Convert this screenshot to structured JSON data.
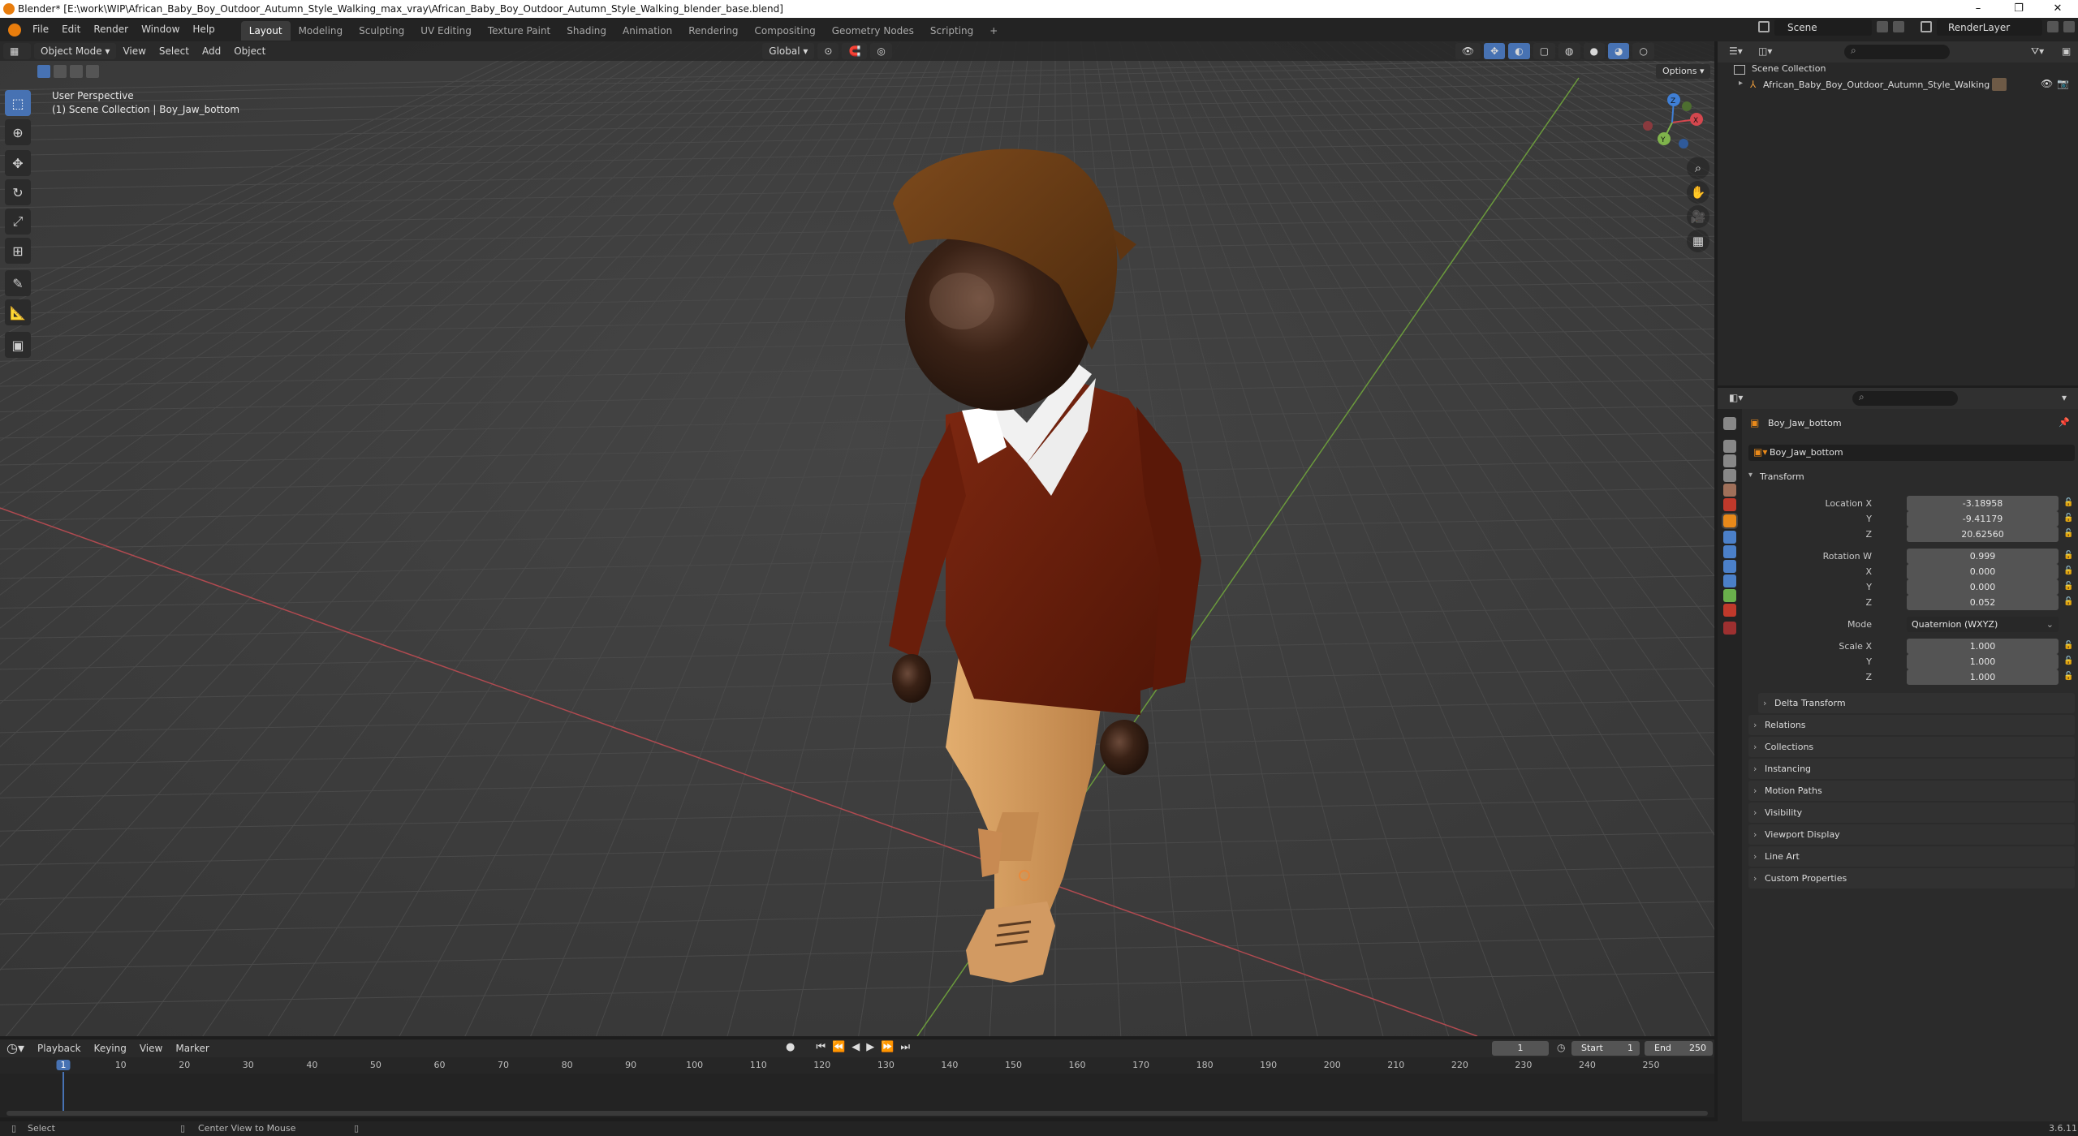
{
  "window": {
    "title": "Blender* [E:\\work\\WIP\\African_Baby_Boy_Outdoor_Autumn_Style_Walking_max_vray\\African_Baby_Boy_Outdoor_Autumn_Style_Walking_blender_base.blend]",
    "minimize": "–",
    "maximize": "❐",
    "close": "✕"
  },
  "menus": [
    "File",
    "Edit",
    "Render",
    "Window",
    "Help"
  ],
  "workspaces": [
    "Layout",
    "Modeling",
    "Sculpting",
    "UV Editing",
    "Texture Paint",
    "Shading",
    "Animation",
    "Rendering",
    "Compositing",
    "Geometry Nodes",
    "Scripting"
  ],
  "add_workspace": "+",
  "scene_name": "Scene",
  "view_layer": "RenderLayer",
  "viewport": {
    "mode": "Object Mode",
    "menus": [
      "View",
      "Select",
      "Add",
      "Object"
    ],
    "orientation": "Global",
    "options": "Options",
    "overlay_line1": "User Perspective",
    "overlay_line2": "(1) Scene Collection | Boy_Jaw_bottom",
    "gizmo_x": "X",
    "gizmo_y": "Y",
    "gizmo_z": "Z"
  },
  "outliner": {
    "root": "Scene Collection",
    "item": "African_Baby_Boy_Outdoor_Autumn_Style_Walking"
  },
  "properties": {
    "object_name": "Boy_Jaw_bottom",
    "data_name": "Boy_Jaw_bottom",
    "transform_label": "Transform",
    "location_label": "Location X",
    "location": [
      "-3.18958",
      "-9.41179",
      "20.62560"
    ],
    "rotation_label": "Rotation W",
    "rotation": [
      "0.999",
      "0.000",
      "0.000",
      "0.052"
    ],
    "mode_label": "Mode",
    "mode_value": "Quaternion (WXYZ)",
    "scale_label": "Scale X",
    "scale": [
      "1.000",
      "1.000",
      "1.000"
    ],
    "axis_y": "Y",
    "axis_z": "Z",
    "axis_x": "X",
    "delta_transform": "Delta Transform",
    "panels": [
      "Relations",
      "Collections",
      "Instancing",
      "Motion Paths",
      "Visibility",
      "Viewport Display",
      "Line Art",
      "Custom Properties"
    ]
  },
  "timeline": {
    "menus": [
      "Playback",
      "Keying",
      "View",
      "Marker"
    ],
    "current_frame": "1",
    "start_label": "Start",
    "start": "1",
    "end_label": "End",
    "end": "250",
    "ticks": [
      "1",
      "10",
      "20",
      "30",
      "40",
      "50",
      "60",
      "70",
      "80",
      "90",
      "100",
      "110",
      "120",
      "130",
      "140",
      "150",
      "160",
      "170",
      "180",
      "190",
      "200",
      "210",
      "220",
      "230",
      "240",
      "250"
    ]
  },
  "status": {
    "select": "Select",
    "center_view": "Center View to Mouse",
    "version": "3.6.11"
  },
  "colors": {
    "accent": "#4772b3",
    "x_axis": "#d4474e",
    "y_axis": "#7fb34b",
    "z_axis": "#3f7fd6",
    "sweater": "#6b1e0c",
    "pants": "#d39a5c",
    "hat": "#6a3c16",
    "skin": "#3a2216"
  }
}
